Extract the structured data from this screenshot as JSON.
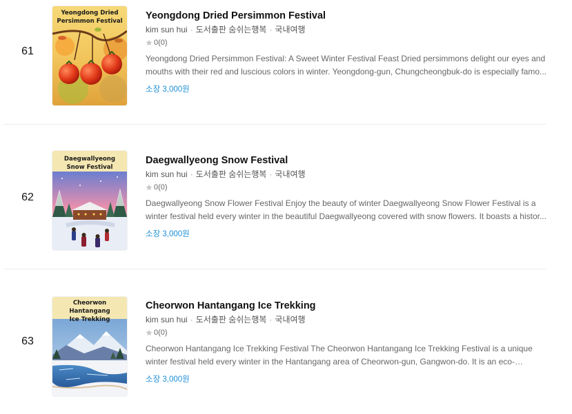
{
  "items": [
    {
      "rank": "61",
      "cover_title_line1": "Yeongdong Dried",
      "cover_title_line2": "Persimmon Festival",
      "title": "Yeongdong Dried Persimmon Festival",
      "author": "kim sun hui",
      "publisher": "도서출판 숨쉬는행복",
      "category": "국내여행",
      "rating": "0(0)",
      "description": "Yeongdong Dried Persimmon Festival: A Sweet Winter Festival Feast Dried persimmons delight our eyes and mouths with their red and luscious colors in winter. Yeongdong-gun, Chungcheongbuk-do is especially famo...",
      "price": "소장 3,000원"
    },
    {
      "rank": "62",
      "cover_title_line1": "Daegwallyeong",
      "cover_title_line2": "Snow Festival",
      "title": "Daegwallyeong Snow Festival",
      "author": "kim sun hui",
      "publisher": "도서출판 숨쉬는행복",
      "category": "국내여행",
      "rating": "0(0)",
      "description": "Daegwallyeong Snow Flower Festival Enjoy the beauty of winter Daegwallyeong Snow Flower Festival is a winter festival held every winter in the beautiful Daegwallyeong covered with snow flowers. It boasts a histor...",
      "price": "소장 3,000원"
    },
    {
      "rank": "63",
      "cover_title_line1": "Cheorwon Hantangang",
      "cover_title_line2": "Ice Trekking",
      "title": "Cheorwon Hantangang Ice Trekking",
      "author": "kim sun hui",
      "publisher": "도서출판 숨쉬는행복",
      "category": "국내여행",
      "rating": "0(0)",
      "description": "Cheorwon Hantangang Ice Trekking Festival The Cheorwon Hantangang Ice Trekking Festival is a unique winter festival held every winter in the Hantangang area of Cheorwon-gun, Gangwon-do. It is an eco-tourism...",
      "price": "소장 3,000원"
    }
  ],
  "colors": {
    "price": "#1e90d6",
    "star": "#c8c8c8",
    "divider": "#ececec"
  },
  "icons": {
    "rating": "star-icon"
  }
}
